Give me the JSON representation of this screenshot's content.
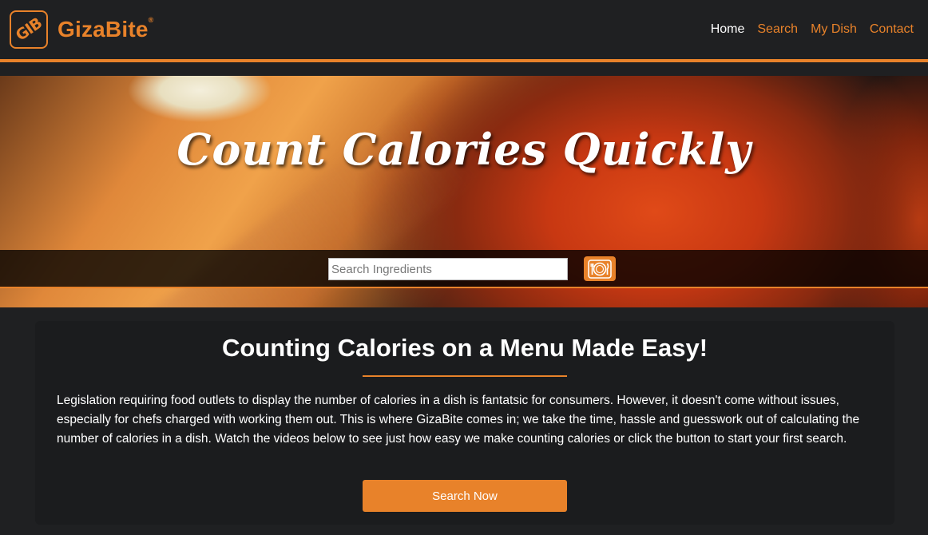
{
  "brand": {
    "logo_text": "GIB",
    "name": "GizaBite",
    "registered_mark": "®",
    "accent_color": "#e8822a"
  },
  "nav": {
    "items": [
      {
        "label": "Home",
        "active": true
      },
      {
        "label": "Search",
        "active": false
      },
      {
        "label": "My Dish",
        "active": false
      },
      {
        "label": "Contact",
        "active": false
      }
    ]
  },
  "hero": {
    "title": "Count Calories Quickly",
    "search": {
      "placeholder": "Search Ingredients",
      "value": "",
      "button_icon": "plate-fork-knife-icon"
    }
  },
  "content": {
    "heading": "Counting Calories on a Menu Made Easy!",
    "body": "Legislation requiring food outlets to display the number of calories in a dish is fantatsic for consumers. However, it doesn't come without issues, especially for chefs charged with working them out. This is where GizaBite comes in; we take the time, hassle and guesswork out of calculating the number of calories in a dish. Watch the videos below to see just how easy we make counting calories or click the button to start your first search.",
    "cta_label": "Search Now"
  }
}
